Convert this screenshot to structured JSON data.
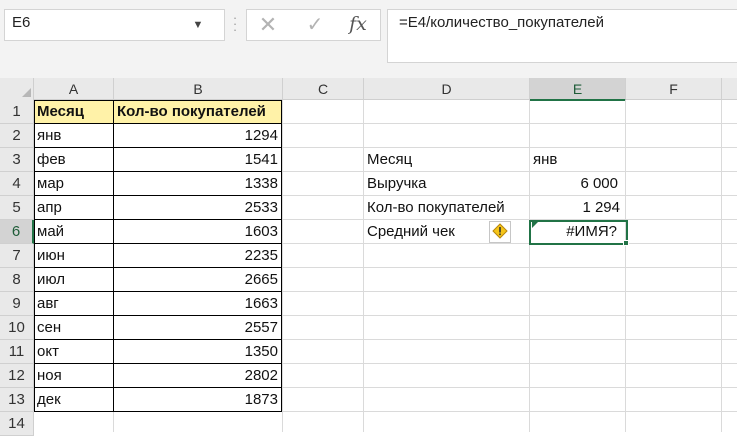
{
  "name_box": {
    "value": "E6"
  },
  "formula_bar": {
    "formula": "=E4/количество_покупателей",
    "fx_label": "fx",
    "cancel_glyph": "✕",
    "enter_glyph": "✓"
  },
  "columns": [
    "A",
    "B",
    "C",
    "D",
    "E",
    "F"
  ],
  "active_column": "E",
  "active_row": "6",
  "rows": [
    "1",
    "2",
    "3",
    "4",
    "5",
    "6",
    "7",
    "8",
    "9",
    "10",
    "11",
    "12",
    "13",
    "14"
  ],
  "table": {
    "headers": {
      "month": "Месяц",
      "buyers": "Кол-во покупателей"
    },
    "data": [
      {
        "month": "янв",
        "buyers": "1294"
      },
      {
        "month": "фев",
        "buyers": "1541"
      },
      {
        "month": "мар",
        "buyers": "1338"
      },
      {
        "month": "апр",
        "buyers": "2533"
      },
      {
        "month": "май",
        "buyers": "1603"
      },
      {
        "month": "июн",
        "buyers": "2235"
      },
      {
        "month": "июл",
        "buyers": "2665"
      },
      {
        "month": "авг",
        "buyers": "1663"
      },
      {
        "month": "сен",
        "buyers": "2557"
      },
      {
        "month": "окт",
        "buyers": "1350"
      },
      {
        "month": "ноя",
        "buyers": "2802"
      },
      {
        "month": "дек",
        "buyers": "1873"
      }
    ]
  },
  "calc": {
    "d3": "Месяц",
    "e3": "янв",
    "d4": "Выручка",
    "e4": "6 000",
    "d5": "Кол-во покупателей",
    "e5": "1 294",
    "d6": "Средний чек",
    "e6": "#ИМЯ?"
  },
  "colors": {
    "header_fill": "#fff2a8",
    "selection": "#217346",
    "warning": "#f5c518"
  },
  "icons": {
    "error_indicator": "warning-icon"
  }
}
